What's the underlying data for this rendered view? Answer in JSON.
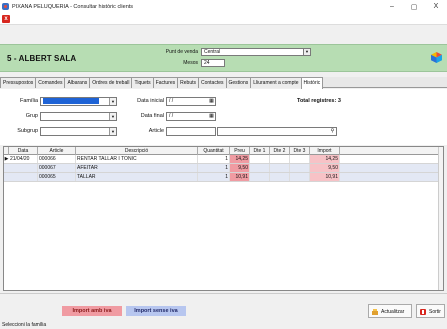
{
  "window": {
    "title": "PIXANA PELUQUERIA - Consultar històric clients",
    "minimize": "–",
    "maximize": "▢",
    "close": "X"
  },
  "toolbar": {
    "close_glyph": "x"
  },
  "header": {
    "client_name": "5 - ALBERT SALA",
    "punt_label": "Punt de venda",
    "punt_value": "Central",
    "mesos_label": "Mesos",
    "mesos_value": "24"
  },
  "tabs": [
    {
      "label": "Pressupostos",
      "active": false
    },
    {
      "label": "Comandes",
      "active": false
    },
    {
      "label": "Albarans",
      "active": false
    },
    {
      "label": "Ordres de treball",
      "active": false
    },
    {
      "label": "Tiquets",
      "active": false
    },
    {
      "label": "Factures",
      "active": false
    },
    {
      "label": "Rebuts",
      "active": false
    },
    {
      "label": "Contactes",
      "active": false
    },
    {
      "label": "Gestions",
      "active": false
    },
    {
      "label": "Lliurament a compte",
      "active": false
    },
    {
      "label": "Històric",
      "active": true
    }
  ],
  "filters": {
    "familia_label": "Família",
    "grup_label": "Grup",
    "subgrup_label": "Subgrup",
    "data_inicial_label": "Data inicial",
    "data_inicial_value": "/ /",
    "data_final_label": "Data final",
    "data_final_value": "/ /",
    "article_label": "Article",
    "total_label": "Total registres: 3"
  },
  "table": {
    "columns": [
      "Data",
      "Article",
      "Descripció",
      "Quantitat",
      "Preu",
      "Dte 1",
      "Dte 2",
      "Dte 3",
      "Import"
    ],
    "rows": [
      {
        "indicator": "▶",
        "date": "21/04/20",
        "article": "000066",
        "desc": "RENTAR TALLAR I TONIC",
        "qty": "1",
        "price": "14,25",
        "d1": "",
        "d2": "",
        "d3": "",
        "amount": "14,25"
      },
      {
        "indicator": "",
        "date": "",
        "article": "000067",
        "desc": "AFEITAR",
        "qty": "1",
        "price": "9,50",
        "d1": "",
        "d2": "",
        "d3": "",
        "amount": "9,50"
      },
      {
        "indicator": "",
        "date": "",
        "article": "000065",
        "desc": "TALLAR",
        "qty": "1",
        "price": "10,91",
        "d1": "",
        "d2": "",
        "d3": "",
        "amount": "10,91"
      }
    ]
  },
  "legend": {
    "with_vat": "Import amb iva",
    "without_vat": "Import sense iva"
  },
  "buttons": {
    "refresh": "Actualitzar",
    "exit": "Sortir"
  },
  "status": "Seleccioni la família",
  "colors": {
    "header_bg": "#b7ddb3",
    "price_cell": "#f09ba2",
    "vat_legend": "#f09ba2",
    "novat_legend": "#b7c6ef",
    "selection": "#1e63d6"
  }
}
